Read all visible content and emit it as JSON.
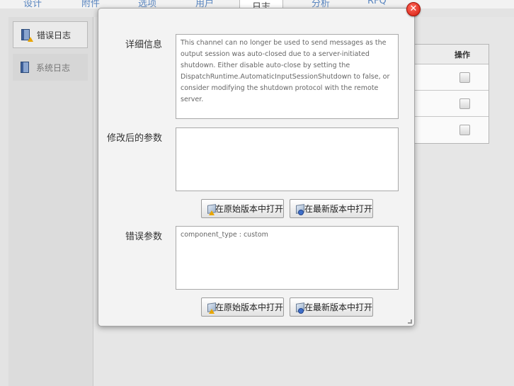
{
  "top_tabs": [
    "设计",
    "附件",
    "选项",
    "用户",
    "日志",
    "分析",
    "RFQ"
  ],
  "sidebar": {
    "items": [
      {
        "label": "错误日志",
        "icon": "log-book-warning-icon"
      },
      {
        "label": "系统日志",
        "icon": "log-book-icon"
      }
    ]
  },
  "background_table": {
    "header_action": "操作",
    "rows": 3
  },
  "modal": {
    "close": "✕",
    "details_label": "详细信息",
    "details_text": "This channel can no longer be used to send messages as the output session was auto-closed due to a server-initiated shutdown. Either disable auto-close by setting the DispatchRuntime.AutomaticInputSessionShutdown to false, or consider modifying the shutdown protocol with the remote server.",
    "modified_params_label": "修改后的参数",
    "modified_params_text": "",
    "error_params_label": "错误参数",
    "error_params_text": "component_type : custom",
    "open_original_label": "在原始版本中打开",
    "open_latest_label": "在最新版本中打开"
  }
}
